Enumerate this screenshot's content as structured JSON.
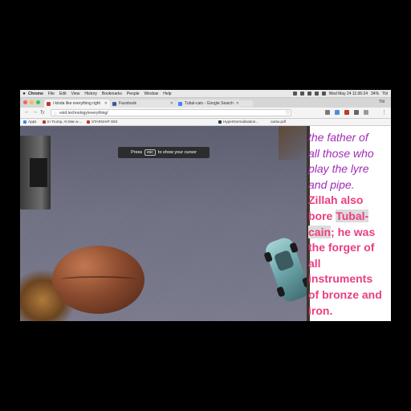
{
  "menubar": {
    "app": "Chrome",
    "items": [
      "File",
      "Edit",
      "View",
      "History",
      "Bookmarks",
      "People",
      "Window",
      "Help"
    ],
    "datetime": "Wed May 24  11:06:24",
    "battery": "34%",
    "user": "Tbl"
  },
  "tabs": [
    {
      "label": "i kinda like everything right",
      "active": true,
      "favicon_color": "#c0392b"
    },
    {
      "label": "Facebook",
      "active": false,
      "favicon_color": "#3b5998"
    },
    {
      "label": "Tubal-cain - Google Search",
      "active": false,
      "favicon_color": "#4285f4"
    }
  ],
  "address": {
    "url": "void.technology/everything/"
  },
  "bookmarks": [
    {
      "label": "Apps",
      "color": "#4285f4"
    },
    {
      "label": "In Trump, At Mar-a-...",
      "color": "#c0392b"
    },
    {
      "label": "STARSHIP Glitt",
      "color": "#c0392b"
    },
    {
      "label": "HyperNormalisation...",
      "color": "#2c3e50"
    },
    {
      "label": "carse.pdf",
      "color": "#888888"
    }
  ],
  "toast": {
    "before": "Press",
    "key": "esc",
    "after": "to show your cursor"
  },
  "passage": {
    "line1": "the father of",
    "line2": "all those who",
    "line3": "play the lyre",
    "line4": "and pipe.",
    "line5": "Zillah also",
    "line6a": "bore ",
    "line6b": "Tubal-",
    "line7a": "cain",
    "line7b": "; he was",
    "line8": "the forger of",
    "line9": "all",
    "line10": "instruments",
    "line11": "of bronze and",
    "line12": "iron."
  },
  "colors": {
    "purple": "#a02bb7",
    "pink": "#ea3e80"
  }
}
